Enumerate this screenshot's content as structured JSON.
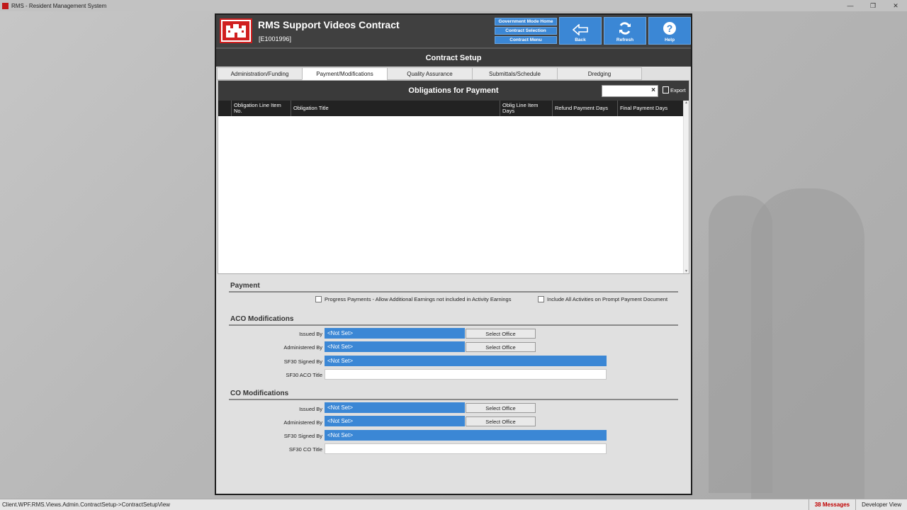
{
  "window": {
    "title": "RMS - Resident Management System",
    "controls": [
      "—",
      "❐",
      "✕"
    ]
  },
  "header": {
    "title": "RMS Support Videos Contract",
    "contract_id": "[E1001996]"
  },
  "nav": {
    "gov_home": "Government Mode Home",
    "contract_selection": "Contract Selection",
    "contract_menu": "Contract Menu",
    "back": "Back",
    "refresh": "Refresh",
    "help": "Help"
  },
  "page_title": "Contract Setup",
  "tabs": [
    {
      "label": "Administration/Funding"
    },
    {
      "label": "Payment/Modifications"
    },
    {
      "label": "Quality Assurance"
    },
    {
      "label": "Submittals/Schedule"
    },
    {
      "label": "Dredging"
    }
  ],
  "active_tab": 1,
  "grid": {
    "title": "Obligations for Payment",
    "search_value": "",
    "clear": "×",
    "export": "Export",
    "columns": [
      "Obligation Line Item No.",
      "Obligation Title",
      "Oblig Line Item Days",
      "Refund Payment Days",
      "Final Payment Days"
    ],
    "rows": []
  },
  "payment": {
    "heading": "Payment",
    "progress_label": "Progress Payments - Allow Additional Earnings not included in Activity Earnings",
    "progress_checked": false,
    "include_label": "Include All Activities on Prompt Payment Document",
    "include_checked": false
  },
  "aco": {
    "heading": "ACO Modifications",
    "issued_label": "Issued By",
    "issued_value": "<Not Set>",
    "admin_label": "Administered By",
    "admin_value": "<Not Set>",
    "signed_label": "SF30 Signed By",
    "signed_value": "<Not Set>",
    "title_label": "SF30 ACO Title",
    "title_value": "",
    "select_office": "Select Office"
  },
  "co": {
    "heading": "CO Modifications",
    "issued_label": "Issued By",
    "issued_value": "<Not Set>",
    "admin_label": "Administered By",
    "admin_value": "<Not Set>",
    "signed_label": "SF30 Signed By",
    "signed_value": "<Not Set>",
    "title_label": "SF30 CO Title",
    "title_value": "",
    "select_office": "Select Office"
  },
  "status": {
    "path": "Client.WPF.RMS.Views.Admin.ContractSetup->ContractSetupView",
    "messages": "38 Messages",
    "view": "Developer View"
  },
  "colors": {
    "accent": "#3b87d5",
    "header": "#404040",
    "logo_red": "#d01f1f"
  }
}
